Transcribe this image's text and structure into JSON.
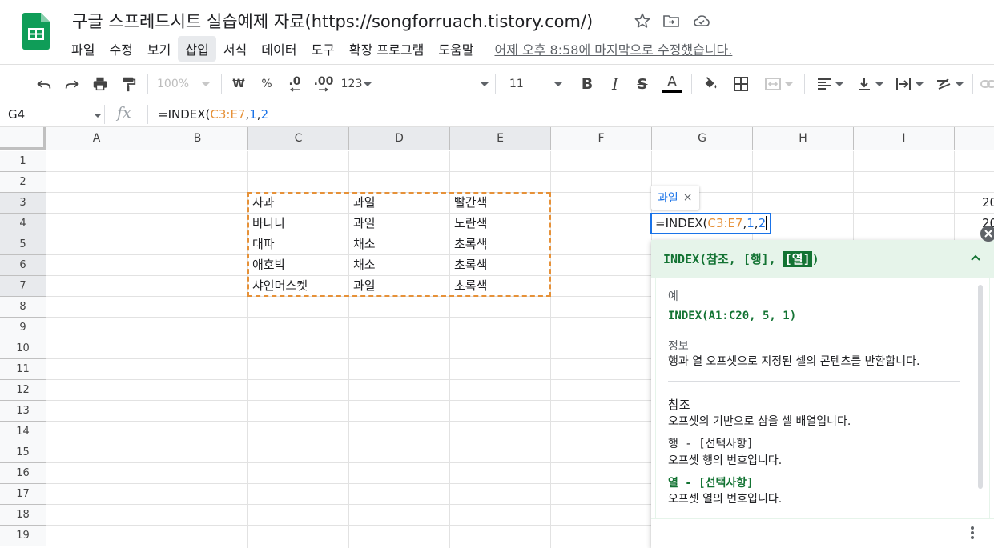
{
  "header": {
    "doc_title": "구글 스프레드시트 실습예제 자료(https://songforruach.tistory.com/)",
    "icons": [
      "star-icon",
      "move-to-folder-icon",
      "cloud-status-icon"
    ]
  },
  "menu": {
    "items": [
      "파일",
      "수정",
      "보기",
      "삽입",
      "서식",
      "데이터",
      "도구",
      "확장 프로그램",
      "도움말"
    ],
    "active_index": 3,
    "last_edit": "어제 오후 8:58에 마지막으로 수정했습니다."
  },
  "toolbar": {
    "zoom": "100%",
    "currency": "₩",
    "percent": "%",
    "decrease_decimal": ".0",
    "increase_decimal": ".00",
    "number_format": "123",
    "font_size": "11"
  },
  "formula_bar": {
    "name_box": "G4",
    "fx": "fx",
    "formula_prefix": "=INDEX(",
    "formula_ref": "C3:E7",
    "formula_sep1": ",",
    "formula_arg1": "1",
    "formula_sep2": ",",
    "formula_arg2": "2"
  },
  "grid": {
    "columns": [
      "A",
      "B",
      "C",
      "D",
      "E",
      "F",
      "G",
      "H",
      "I"
    ],
    "selected_columns": [
      "C",
      "D",
      "E"
    ],
    "rows": [
      "1",
      "2",
      "3",
      "4",
      "5",
      "6",
      "7",
      "8",
      "9",
      "10",
      "11",
      "12",
      "13",
      "14",
      "15",
      "16",
      "17",
      "18",
      "19"
    ],
    "selected_rows": [
      "3",
      "4",
      "5",
      "6",
      "7"
    ],
    "data": [
      [
        "사과",
        "과일",
        "빨간색"
      ],
      [
        "바나나",
        "과일",
        "노란색"
      ],
      [
        "대파",
        "채소",
        "초록색"
      ],
      [
        "애호박",
        "채소",
        "초록색"
      ],
      [
        "샤인머스켓",
        "과일",
        "초록색"
      ]
    ],
    "edge_values": [
      "20",
      "20"
    ]
  },
  "editor": {
    "tooltip_value": "과일",
    "tooltip_close": "×"
  },
  "help": {
    "signature_prefix": "INDEX(참조, [행], ",
    "signature_highlight": "[열]",
    "signature_suffix": ")",
    "example_label": "예",
    "example": "INDEX(A1:C20, 5, 1)",
    "info_label": "정보",
    "info_text": "행과 열 오프셋으로 지정된 셀의 콘텐츠를 반환합니다.",
    "ref_title": "참조",
    "ref_text": "오프셋의 기반으로 삼을 셀 배열입니다.",
    "row_title": "행 - [선택사항]",
    "row_text": "오프셋 행의 번호입니다.",
    "col_title": "열 - [선택사항]",
    "col_text": "오프셋 열의 번호입니다."
  },
  "colors": {
    "accent": "#1a73e8",
    "range_highlight": "#e69138",
    "help_green": "#137333",
    "help_header_bg": "#e6f4ea",
    "sheets_green": "#0f9d58"
  }
}
